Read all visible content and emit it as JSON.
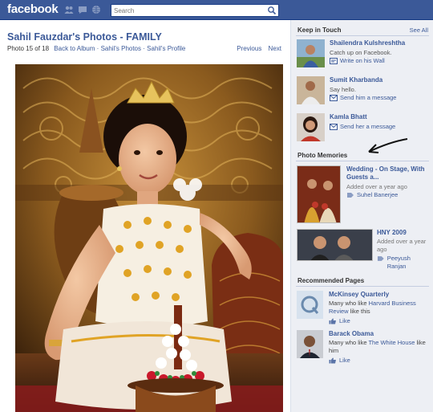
{
  "app": {
    "logo": "facebook"
  },
  "search": {
    "placeholder": "Search"
  },
  "album": {
    "title": "Sahil Fauzdar's Photos - FAMILY",
    "counter": "Photo 15 of 18",
    "back_to_album": "Back to Album",
    "bullet": "·",
    "owner_photos": "Sahil's Photos",
    "owner_profile": "Sahil's Profile",
    "previous": "Previous",
    "next": "Next"
  },
  "keep_in_touch": {
    "title": "Keep in Touch",
    "see_all": "See All",
    "people": [
      {
        "name": "Shailendra Kulshreshtha",
        "status": "Catch up on Facebook.",
        "action": "Write on his Wall"
      },
      {
        "name": "Sumit Kharbanda",
        "status": "Say hello.",
        "action": "Send him a message"
      },
      {
        "name": "Kamla Bhatt",
        "status": "Send her a message",
        "action": ""
      }
    ]
  },
  "photo_memories": {
    "title": "Photo Memories",
    "items": [
      {
        "title": "Wedding - On Stage, With Guests a...",
        "date": "Added over a year ago",
        "tag": "Suhel Banerjee"
      },
      {
        "title": "HNY 2009",
        "date": "Added over a year ago",
        "tag": "Peeyush Ranjan"
      }
    ]
  },
  "recommended_pages": {
    "title": "Recommended Pages",
    "pages": [
      {
        "name": "McKinsey Quarterly",
        "desc_prefix": "Many who like ",
        "desc_link": "Harvard Business Review",
        "desc_suffix": " like this",
        "like": "Like"
      },
      {
        "name": "Barack Obama",
        "desc_prefix": "Many who like ",
        "desc_link": "The White House",
        "desc_suffix": " like him",
        "like": "Like"
      }
    ]
  },
  "colors": {
    "brand": "#3b5998",
    "sidebar": "#edeff4"
  }
}
